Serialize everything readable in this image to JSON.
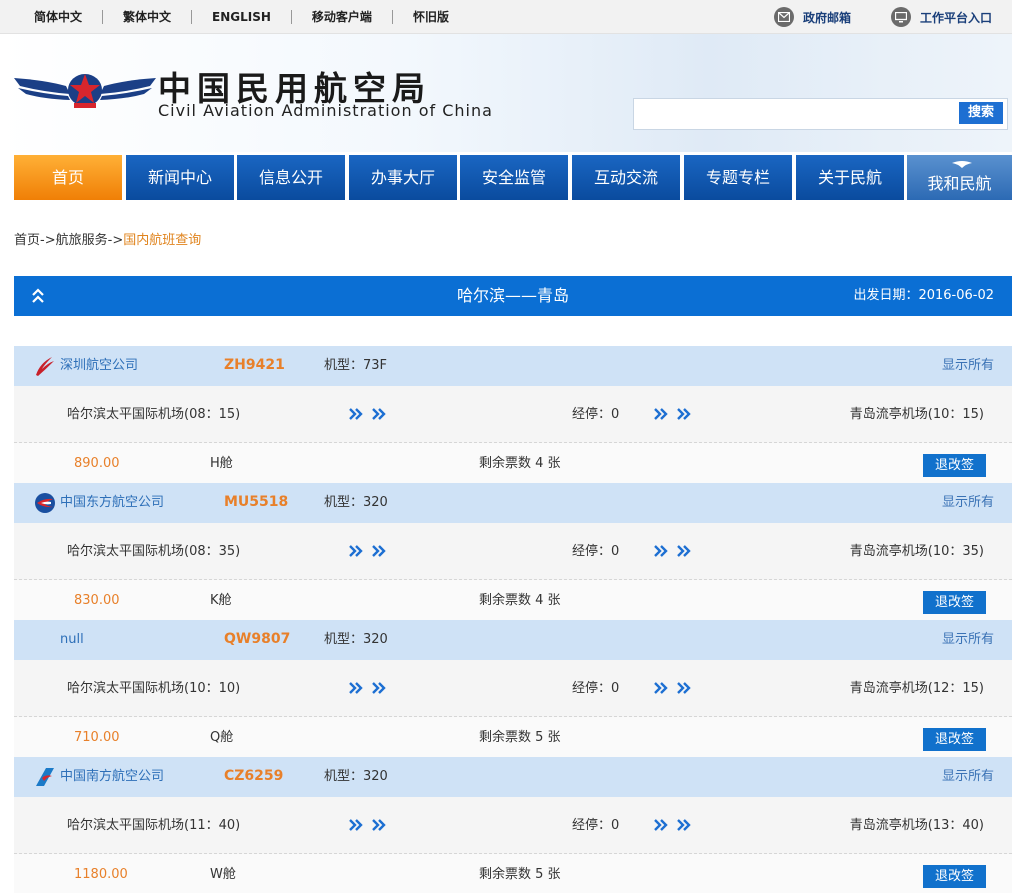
{
  "topbar": {
    "links": [
      "简体中文",
      "繁体中文",
      "ENGLISH",
      "移动客户端",
      "怀旧版"
    ],
    "mail_label": "政府邮箱",
    "portal_label": "工作平台入口"
  },
  "header": {
    "title_cn": "中国民用航空局",
    "title_en": "Civil Aviation Administration of China",
    "search_placeholder": "",
    "search_button": "搜索"
  },
  "nav": [
    "首页",
    "新闻中心",
    "信息公开",
    "办事大厅",
    "安全监管",
    "互动交流",
    "专题专栏",
    "关于民航",
    "我和民航"
  ],
  "breadcrumb": {
    "home": "首页",
    "sep": "->",
    "section": "航旅服务",
    "current": "国内航班查询"
  },
  "route": {
    "title": "哈尔滨——青岛",
    "date_label": "出发日期：2016-06-02"
  },
  "flights": [
    {
      "airline": "深圳航空公司",
      "flight_no": "ZH9421",
      "aircraft": "机型：73F",
      "show_all": "显示所有",
      "departure": "哈尔滨太平国际机场(08：15)",
      "stops": "经停：0",
      "arrival": "青岛流亭机场(10：15)",
      "price": "890.00",
      "cabin": "H舱",
      "remaining": "剩余票数 4 张",
      "button": "退改签",
      "logo_color": "#c8202a"
    },
    {
      "airline": "中国东方航空公司",
      "flight_no": "MU5518",
      "aircraft": "机型：320",
      "show_all": "显示所有",
      "departure": "哈尔滨太平国际机场(08：35)",
      "stops": "经停：0",
      "arrival": "青岛流亭机场(10：35)",
      "price": "830.00",
      "cabin": "K舱",
      "remaining": "剩余票数 4 张",
      "button": "退改签",
      "logo_color": "#1a4fa0"
    },
    {
      "airline": "null",
      "flight_no": "QW9807",
      "aircraft": "机型：320",
      "show_all": "显示所有",
      "departure": "哈尔滨太平国际机场(10：10)",
      "stops": "经停：0",
      "arrival": "青岛流亭机场(12：15)",
      "price": "710.00",
      "cabin": "Q舱",
      "remaining": "剩余票数 5 张",
      "button": "退改签",
      "logo_color": ""
    },
    {
      "airline": "中国南方航空公司",
      "flight_no": "CZ6259",
      "aircraft": "机型：320",
      "show_all": "显示所有",
      "departure": "哈尔滨太平国际机场(11：40)",
      "stops": "经停：0",
      "arrival": "青岛流亭机场(13：40)",
      "price": "1180.00",
      "cabin": "W舱",
      "remaining": "剩余票数 5 张",
      "button": "退改签",
      "logo_color": "#1b7ac8"
    }
  ],
  "colors": {
    "nav_blue": "#0a4b9e",
    "nav_active": "#f07f06",
    "route_bar": "#0b6fd4",
    "flight_header": "#cfe2f6",
    "price_orange": "#e8802a"
  }
}
